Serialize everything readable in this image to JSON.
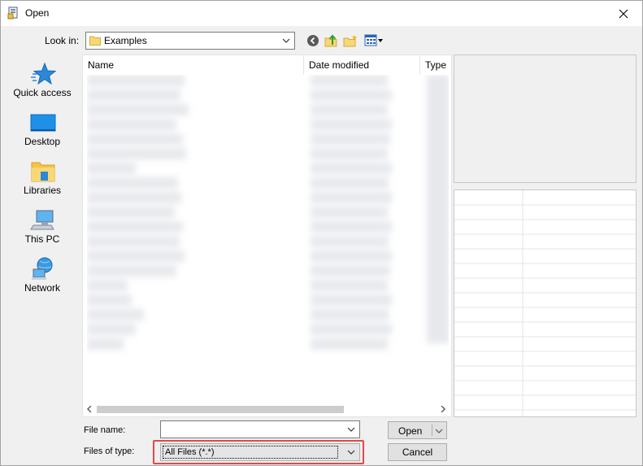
{
  "window": {
    "title": "Open"
  },
  "toolbar": {
    "look_in_label": "Look in:",
    "look_in_value": "Examples"
  },
  "places": [
    {
      "label": "Quick access",
      "icon": "star-icon"
    },
    {
      "label": "Desktop",
      "icon": "desktop-icon"
    },
    {
      "label": "Libraries",
      "icon": "libraries-icon"
    },
    {
      "label": "This PC",
      "icon": "computer-icon"
    },
    {
      "label": "Network",
      "icon": "network-icon"
    }
  ],
  "filelist": {
    "columns": [
      "Name",
      "Date modified",
      "Type"
    ]
  },
  "form": {
    "file_name_label": "File name:",
    "file_name_value": "",
    "file_type_label": "Files of type:",
    "file_type_value": "All Files (*.*)"
  },
  "buttons": {
    "open": "Open",
    "cancel": "Cancel"
  },
  "colors": {
    "highlight": "#e34848",
    "accent": "#0078d7"
  }
}
